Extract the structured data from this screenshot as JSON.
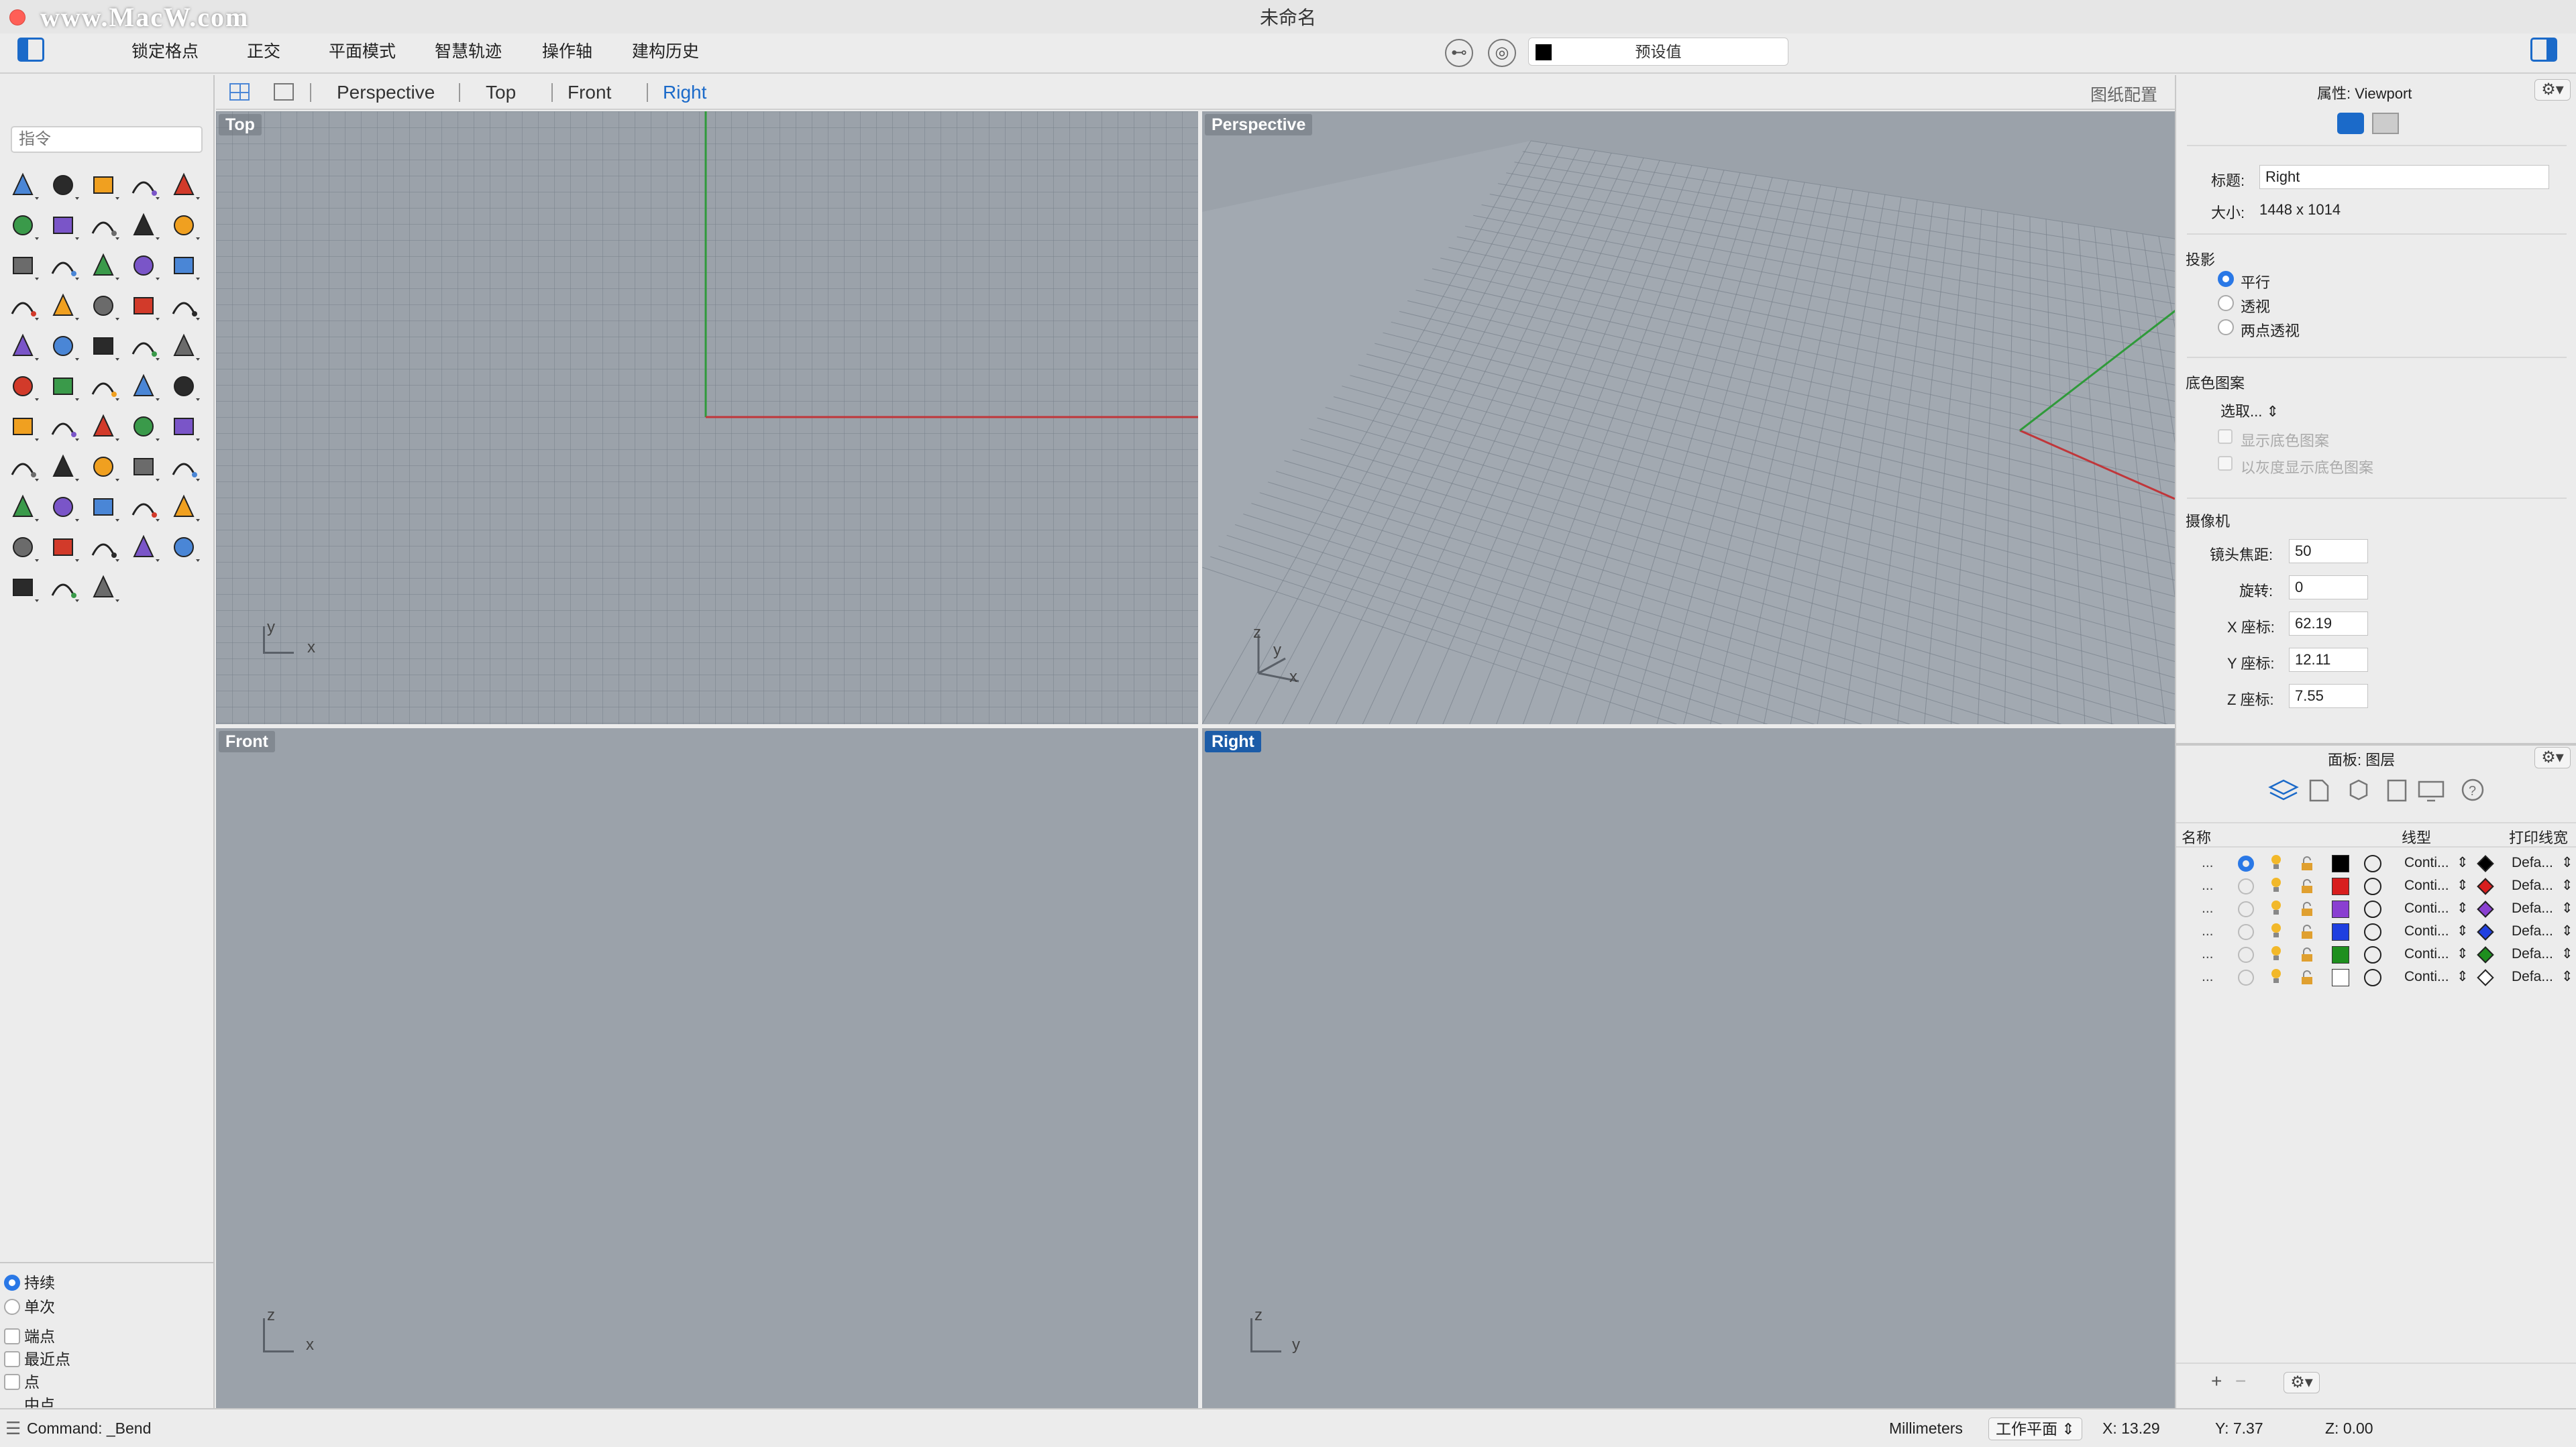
{
  "window": {
    "title": "未命名",
    "watermark": "www.MacW.com"
  },
  "toolbar": {
    "buttons": [
      {
        "label": "锁定格点",
        "on": true
      },
      {
        "label": "正交",
        "on": false
      },
      {
        "label": "平面模式",
        "on": false
      },
      {
        "label": "智慧轨迹",
        "on": false
      },
      {
        "label": "操作轴",
        "on": false
      },
      {
        "label": "建构历史",
        "on": true
      }
    ],
    "preset_label": "预设值"
  },
  "viewport_tabs": {
    "tabs": [
      "Perspective",
      "Top",
      "Front",
      "Right"
    ],
    "active": "Right",
    "layout_label": "图纸配置"
  },
  "viewports": {
    "top": {
      "title": "Top",
      "axis1": "y",
      "axis2": "x"
    },
    "perspective": {
      "title": "Perspective",
      "axis1": "z",
      "axis2": "y",
      "axis3": "x"
    },
    "front": {
      "title": "Front",
      "axis1": "z",
      "axis2": "x"
    },
    "right": {
      "title": "Right",
      "axis1": "z",
      "axis2": "y"
    }
  },
  "command": {
    "placeholder": "指令",
    "last": "Command: _Bend"
  },
  "tool_icons": [
    "select-arrow-icon",
    "point-icon",
    "polyline-icon",
    "curve-icon",
    "circle-icon",
    "ellipse-icon",
    "arc-icon",
    "rectangle-icon",
    "polygon-icon",
    "fillet-curve-icon",
    "surface-icon",
    "revolve-icon",
    "box-icon",
    "sphere-icon",
    "cylinder-icon",
    "plane-icon",
    "explode-icon",
    "boolean-icon",
    "split-icon",
    "trim-icon",
    "group-icon",
    "array-icon",
    "fillet-icon",
    "offset-icon",
    "text-icon",
    "scale-icon",
    "transform-icon",
    "dimension-icon",
    "solid-edit-icon",
    "mesh-icon",
    "grid-array-icon",
    "align-icon",
    "analyze-icon",
    "check-icon",
    "shade-icon",
    "hide-icon",
    "zoom-icon",
    "zoom-window-icon",
    "zoom-extents-icon",
    "zoom-selected-icon",
    "rotate-view-icon",
    "car-icon",
    "render-icon",
    "light-set-icon",
    "light-icon",
    "lock-icon",
    "material-icon",
    "color-wheel-icon",
    "render-sphere-icon",
    "display-mode-icon",
    "blue-sphere-icon",
    "cone-icon",
    "gumball-icon"
  ],
  "osnap": {
    "continuous": "持续",
    "once": "单次",
    "items": [
      "端点",
      "最近点",
      "点",
      "中点"
    ]
  },
  "properties": {
    "header": "属性: Viewport",
    "title_label": "标题:",
    "title_value": "Right",
    "size_label": "大小:",
    "size_value": "1448 x 1014",
    "projection_label": "投影",
    "projection_options": [
      "平行",
      "透视",
      "两点透视"
    ],
    "projection_selected": "平行",
    "wallpaper_label": "底色图案",
    "wallpaper_select": "选取...",
    "wallpaper_show": "显示底色图案",
    "wallpaper_gray": "以灰度显示底色图案",
    "camera_label": "摄像机",
    "lens_label": "镜头焦距:",
    "lens_value": "50",
    "rotation_label": "旋转:",
    "rotation_value": "0",
    "x_label": "X 座标:",
    "x_value": "62.19",
    "y_label": "Y 座标:",
    "y_value": "12.11",
    "z_label": "Z 座标:",
    "z_value": "7.55"
  },
  "layers_panel": {
    "header": "面板: 图层",
    "col_name": "名称",
    "col_linetype": "线型",
    "col_printwidth": "打印线宽",
    "rows": [
      {
        "dots": "...",
        "current": true,
        "color": "#000000",
        "linetype": "Conti...",
        "printwidth": "Defa..."
      },
      {
        "dots": "...",
        "current": false,
        "color": "#d81e1e",
        "linetype": "Conti...",
        "printwidth": "Defa..."
      },
      {
        "dots": "...",
        "current": false,
        "color": "#8a3fd1",
        "linetype": "Conti...",
        "printwidth": "Defa..."
      },
      {
        "dots": "...",
        "current": false,
        "color": "#1f3fe0",
        "linetype": "Conti...",
        "printwidth": "Defa..."
      },
      {
        "dots": "...",
        "current": false,
        "color": "#1e8f1e",
        "linetype": "Conti...",
        "printwidth": "Defa..."
      },
      {
        "dots": "...",
        "current": false,
        "color": "#ffffff",
        "linetype": "Conti...",
        "printwidth": "Defa..."
      }
    ],
    "add_label": "+",
    "remove_label": "−"
  },
  "status": {
    "units": "Millimeters",
    "cplane": "工作平面",
    "x": "X: 13.29",
    "y": "Y: 7.37",
    "z": "Z: 0.00"
  },
  "colors": {
    "accent": "#1b6ac9",
    "viewport_bg": "#9ba2aa",
    "x_axis": "#c0363a",
    "y_axis": "#2f9a3a"
  }
}
